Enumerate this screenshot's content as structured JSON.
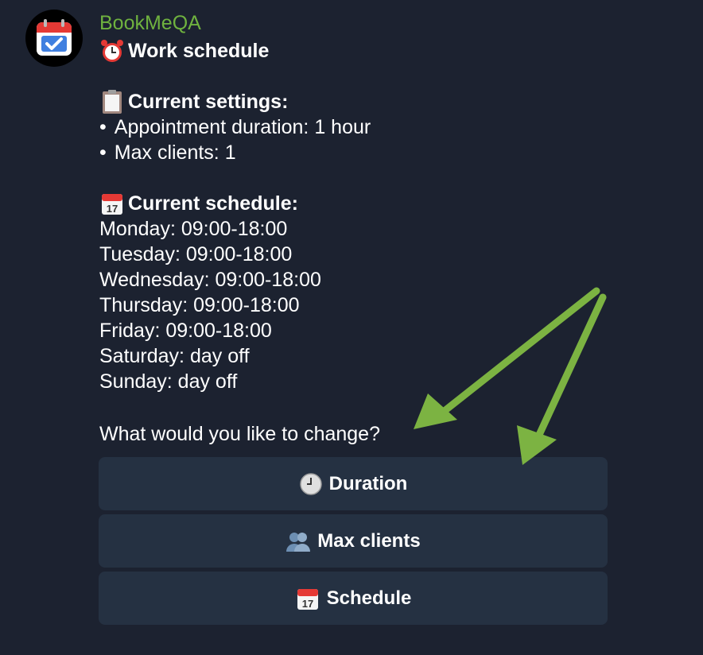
{
  "bot": {
    "name": "BookMeQA",
    "avatar_icon": "calendar-check-icon",
    "name_color": "#6fb23f"
  },
  "message": {
    "title": "Work schedule",
    "title_icon": "alarm-clock-icon",
    "settings_heading": "Current settings:",
    "settings_icon": "clipboard-icon",
    "settings": [
      "Appointment duration: 1 hour",
      "Max clients: 1"
    ],
    "schedule_heading": "Current schedule:",
    "schedule_icon": "calendar-icon",
    "schedule": [
      "Monday: 09:00-18:00",
      "Tuesday: 09:00-18:00",
      "Wednesday: 09:00-18:00",
      "Thursday: 09:00-18:00",
      "Friday: 09:00-18:00",
      "Saturday: day off",
      "Sunday: day off"
    ],
    "question": "What would you like to change?"
  },
  "keyboard": {
    "buttons": [
      {
        "label": "Duration",
        "icon": "clock-icon"
      },
      {
        "label": "Max clients",
        "icon": "people-icon"
      },
      {
        "label": "Schedule",
        "icon": "calendar-icon"
      }
    ]
  },
  "colors": {
    "background": "#1c2230",
    "button_bg": "#253142",
    "annotation_arrow": "#7cb342"
  }
}
